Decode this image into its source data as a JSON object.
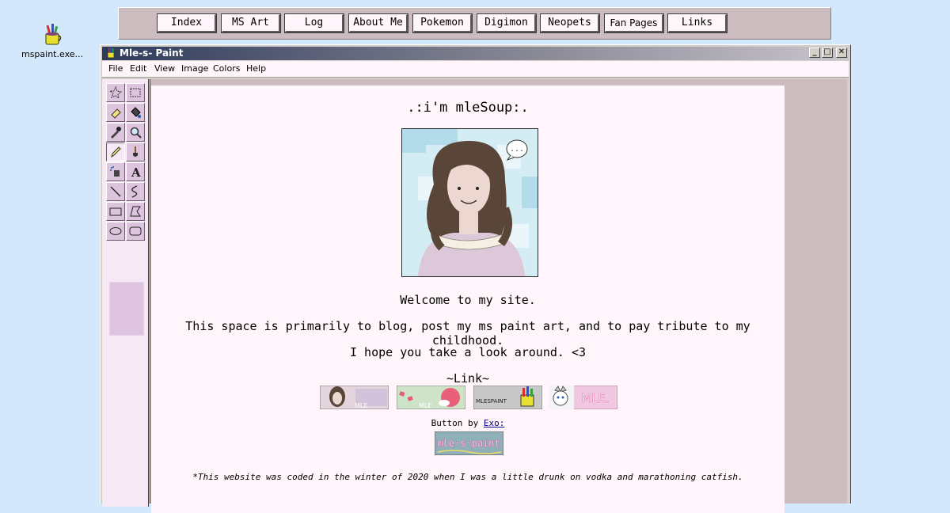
{
  "desktop": {
    "icon_label": "mspaint.exe..."
  },
  "nav": [
    "Index",
    "MS Art",
    "Log",
    "About Me",
    "Pokemon",
    "Digimon",
    "Neopets",
    "Fan Pages",
    "Links"
  ],
  "window": {
    "title": "Mle-s- Paint",
    "controls": {
      "minimize": "_",
      "maximize": "□",
      "close": "✕"
    }
  },
  "menu": [
    "File",
    "Edit",
    "View",
    "Image",
    "Colors",
    "Help"
  ],
  "tools": [
    "free-select-icon",
    "rect-select-icon",
    "eraser-icon",
    "fill-bucket-icon",
    "color-picker-icon",
    "magnifier-icon",
    "pencil-icon",
    "brush-icon",
    "airbrush-icon",
    "text-icon",
    "line-icon",
    "curve-icon",
    "rectangle-icon",
    "polygon-icon",
    "ellipse-icon",
    "rounded-rect-icon"
  ],
  "content": {
    "heading": ".:i'm mleSoup:.",
    "speech_bubble": "...",
    "welcome": "Welcome to my site.",
    "intro": "This space is primarily to blog, post my ms paint art, and to pay tribute to my childhood.",
    "hope": "I hope you take a look around. <3",
    "link_label": "~Link~",
    "button_texts": [
      "MLE",
      "MLE",
      "MLESPAINT",
      "MLE."
    ],
    "credit_prefix": "Button by ",
    "credit_link": "Exo:",
    "mlespaint_button": "mle·s·paint",
    "footer": "*This website was coded in the winter of 2020 when I was a little drunk on vodka and marathoning catfish."
  },
  "colors": {
    "desktop": "#d4e8fb",
    "canvas": "#fff5fb",
    "workspace": "#cdbcbf",
    "toolbox": "#f7e8f5",
    "link": "#00008b"
  }
}
